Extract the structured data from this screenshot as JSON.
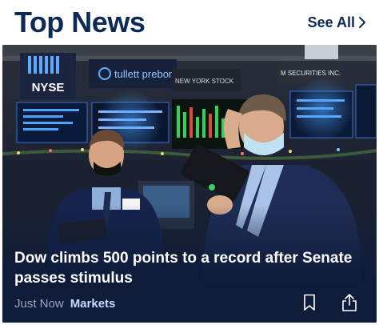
{
  "header": {
    "title": "Top News",
    "see_all_label": "See All"
  },
  "story": {
    "headline": "Dow climbs 500 points to a record after Senate passes stimulus",
    "time": "Just Now",
    "category": "Markets",
    "photo_signs": {
      "nyse": "NYSE",
      "tullett": "tullett prebon",
      "board": "NEW YORK STOCK",
      "securities": "M SECURITIES INC."
    }
  },
  "colors": {
    "brand_navy": "#0d2a55",
    "card_bg": "#0e1c3a",
    "category_link": "#c9dcff",
    "meta_text": "#9aa6bf"
  },
  "icons": [
    "chevron-right-icon",
    "bookmark-icon",
    "share-icon"
  ]
}
